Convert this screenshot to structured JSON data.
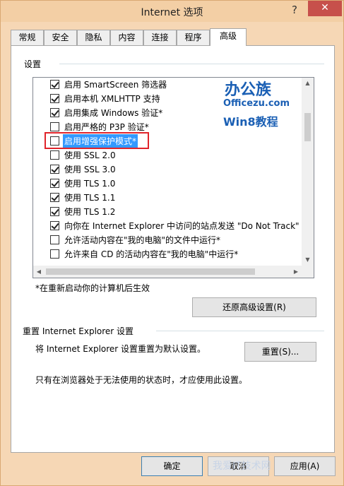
{
  "window": {
    "title": "Internet 选项",
    "help": "?",
    "close": "✕"
  },
  "tabs": [
    {
      "label": "常规"
    },
    {
      "label": "安全"
    },
    {
      "label": "隐私"
    },
    {
      "label": "内容"
    },
    {
      "label": "连接"
    },
    {
      "label": "程序"
    },
    {
      "label": "高级",
      "active": true
    }
  ],
  "settings": {
    "group_label": "设置",
    "items": [
      {
        "label": "启用 SmartScreen 筛选器",
        "checked": true
      },
      {
        "label": "启用本机 XMLHTTP 支持",
        "checked": true
      },
      {
        "label": "启用集成 Windows 验证*",
        "checked": true
      },
      {
        "label": "启用严格的 P3P 验证*",
        "checked": false
      },
      {
        "label": "启用增强保护模式*",
        "checked": false,
        "selected": true
      },
      {
        "label": "使用 SSL 2.0",
        "checked": false
      },
      {
        "label": "使用 SSL 3.0",
        "checked": true
      },
      {
        "label": "使用 TLS 1.0",
        "checked": true
      },
      {
        "label": "使用 TLS 1.1",
        "checked": true
      },
      {
        "label": "使用 TLS 1.2",
        "checked": true
      },
      {
        "label": "向你在 Internet Explorer 中访问的站点发送 \"Do Not Track\"",
        "checked": true
      },
      {
        "label": "允许活动内容在\"我的电脑\"的文件中运行*",
        "checked": false
      },
      {
        "label": "允许来自 CD 的活动内容在\"我的电脑\"中运行*",
        "checked": false
      }
    ],
    "restart_note": "*在重新启动你的计算机后生效",
    "restore_button": "还原高级设置(R)"
  },
  "reset": {
    "section_label": "重置 Internet Explorer 设置",
    "description": "将 Internet Explorer 设置重置为默认设置。",
    "button": "重置(S)...",
    "note": "只有在浏览器处于无法使用的状态时，才应使用此设置。"
  },
  "footer": {
    "ok": "确定",
    "cancel": "取消",
    "apply": "应用(A)"
  },
  "watermark": {
    "line1": "办公族",
    "line2": "Officezu.com",
    "line3": "Win8教程",
    "bottom": "我爱IT技术网"
  }
}
